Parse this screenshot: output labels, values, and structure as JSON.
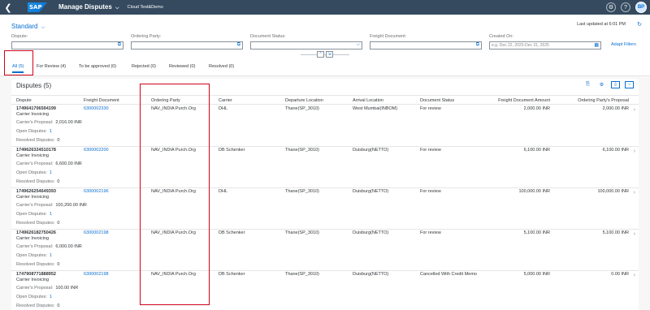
{
  "shell": {
    "logo": "SAP",
    "app_title": "Manage Disputes",
    "app_chevron": "⌵",
    "subtitle": "Cloud Test&Demo",
    "avatar": "BP"
  },
  "header": {
    "variant": "Standard",
    "variant_chevron": "⌵",
    "last_updated": "Last updated at 6:01 PM",
    "adapt_filters": "Adapt Filters",
    "filters": [
      {
        "label": "Dispute:",
        "value": "",
        "placeholder": ""
      },
      {
        "label": "Ordering Party:",
        "value": "",
        "placeholder": ""
      },
      {
        "label": "Document Status:",
        "value": "",
        "placeholder": ""
      },
      {
        "label": "Freight Document:",
        "value": "",
        "placeholder": ""
      },
      {
        "label": "Created On:",
        "value": "",
        "placeholder": "e.g. Dec 22, 2025-Dec 31, 2025"
      }
    ]
  },
  "tabs": [
    {
      "label": "All (5)",
      "selected": true
    },
    {
      "label": "For Review (4)",
      "selected": false
    },
    {
      "label": "To be approved (0)",
      "selected": false
    },
    {
      "label": "Rejected (0)",
      "selected": false
    },
    {
      "label": "Reviewed (0)",
      "selected": false
    },
    {
      "label": "Resolved (0)",
      "selected": false
    }
  ],
  "table": {
    "title": "Disputes (5)",
    "columns": [
      "Dispute",
      "Freight Document",
      "Ordering Party",
      "Carrier",
      "Departure Location",
      "Arrival Location",
      "Document Status",
      "Freight Document Amount",
      "Ordering Party's Proposal"
    ],
    "rows": [
      {
        "id": "1749641706594199",
        "type": "Carrier Invoicing",
        "carrier_proposal_label": "Carrier's Proposal:",
        "carrier_proposal": "2,016.00 INR",
        "open_label": "Open Disputes:",
        "open": "1",
        "resolved_label": "Resolved Disputes:",
        "resolved": "0",
        "freight_doc": "6300002330",
        "ordering_party": "NAV_INDIA Purch.Org",
        "carrier": "DHL",
        "departure": "Thane(SP_3010)",
        "arrival": "West Mumbai(INBOM)",
        "status": "For review",
        "amount": "2,000.00 INR",
        "op_proposal": "2,000.00 INR"
      },
      {
        "id": "1749626324510178",
        "type": "Carrier Invoicing",
        "carrier_proposal_label": "Carrier's Proposal:",
        "carrier_proposal": "6,600.00 INR",
        "open_label": "Open Disputes:",
        "open": "1",
        "resolved_label": "Resolved Disputes:",
        "resolved": "0",
        "freight_doc": "6300002200",
        "ordering_party": "NAV_INDIA Purch.Org",
        "carrier": "DB Schenker",
        "departure": "Thane(SP_3010)",
        "arrival": "Duisburg(NETTO)",
        "status": "For review",
        "amount": "6,100.00 INR",
        "op_proposal": "6,100.00 INR"
      },
      {
        "id": "1749626254649393",
        "type": "Carrier Invoicing",
        "carrier_proposal_label": "Carrier's Proposal:",
        "carrier_proposal": "100,200.00 INR",
        "open_label": "Open Disputes:",
        "open": "1",
        "resolved_label": "Resolved Disputes:",
        "resolved": "0",
        "freight_doc": "6300002196",
        "ordering_party": "NAV_INDIA Purch.Org",
        "carrier": "DHL",
        "departure": "Thane(SP_3010)",
        "arrival": "Duisburg(NETTO)",
        "status": "For review",
        "amount": "100,000.00 INR",
        "op_proposal": "100,000.00 INR"
      },
      {
        "id": "1749626182750426",
        "type": "Carrier Invoicing",
        "carrier_proposal_label": "Carrier's Proposal:",
        "carrier_proposal": "6,000.00 INR",
        "open_label": "Open Disputes:",
        "open": "1",
        "resolved_label": "Resolved Disputes:",
        "resolved": "0",
        "freight_doc": "6300002198",
        "ordering_party": "NAV_INDIA Purch.Org",
        "carrier": "DB Schenker",
        "departure": "Thane(SP_3010)",
        "arrival": "Duisburg(NETTO)",
        "status": "For review",
        "amount": "5,100.00 INR",
        "op_proposal": "5,100.00 INR"
      },
      {
        "id": "1747908771888952",
        "type": "Carrier Invoicing",
        "carrier_proposal_label": "Carrier's Proposal:",
        "carrier_proposal": "100.00 INR",
        "open_label": "Open Disputes:",
        "open": "1",
        "resolved_label": "Resolved Disputes:",
        "resolved": "0",
        "freight_doc": "6300002198",
        "ordering_party": "NAV_INDIA Purch.Org",
        "carrier": "DB Schenker",
        "departure": "Thane(SP_3010)",
        "arrival": "Duisburg(NETTO)",
        "status": "Cancelled With Credit Memo",
        "amount": "5,000.00 INR",
        "op_proposal": "0.00 INR"
      }
    ]
  },
  "icons": {
    "back": "back-icon",
    "value_help": "value-help-icon",
    "calendar": "calendar-icon",
    "refresh": "refresh-icon",
    "settings": "settings-icon",
    "help": "help-icon",
    "nav": "navigation-arrow-icon"
  },
  "colors": {
    "shell_bg": "#354a5f",
    "link": "#0a6ed1",
    "highlight_box": "#d0021b"
  }
}
